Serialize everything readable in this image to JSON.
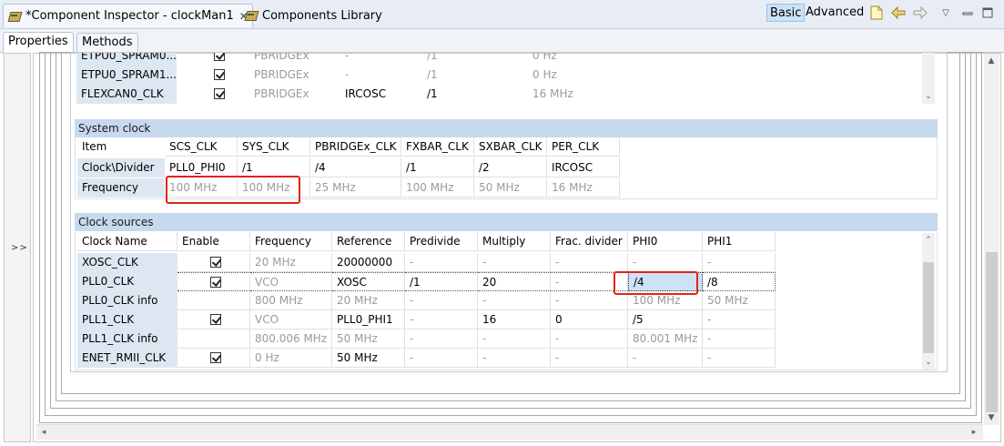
{
  "tabs": {
    "inspector": "*Component Inspector - clockMan1",
    "library": "Components Library"
  },
  "modes": {
    "basic": "Basic",
    "advanced": "Advanced"
  },
  "subtabs": {
    "properties": "Properties",
    "methods": "Methods"
  },
  "collapse_label": ">>",
  "top_table": {
    "rows": [
      {
        "name": "ETPU0_SPRAM0...",
        "enabled": true,
        "bus": "PBRIDGEx",
        "source": "-",
        "divider": "/1",
        "freq": "0 Hz"
      },
      {
        "name": "ETPU0_SPRAM1...",
        "enabled": true,
        "bus": "PBRIDGEx",
        "source": "-",
        "divider": "/1",
        "freq": "0 Hz"
      },
      {
        "name": "FLEXCAN0_CLK",
        "enabled": true,
        "bus": "PBRIDGEx",
        "source": "IRCOSC",
        "divider": "/1",
        "freq": "16 MHz"
      }
    ]
  },
  "system_clock": {
    "title": "System clock",
    "headers": [
      "Item",
      "SCS_CLK",
      "SYS_CLK",
      "PBRIDGEx_CLK",
      "FXBAR_CLK",
      "SXBAR_CLK",
      "PER_CLK"
    ],
    "divider_row": [
      "Clock\\Divider",
      "PLL0_PHI0",
      "/1",
      "/4",
      "/1",
      "/2",
      "IRCOSC"
    ],
    "frequency_row": [
      "Frequency",
      "100 MHz",
      "100 MHz",
      "25 MHz",
      "100 MHz",
      "50 MHz",
      "16 MHz"
    ]
  },
  "clock_sources": {
    "title": "Clock sources",
    "headers": [
      "Clock Name",
      "Enable",
      "Frequency",
      "Reference",
      "Predivide",
      "Multiply",
      "Frac. divider",
      "PHI0",
      "PHI1"
    ],
    "rows": [
      {
        "name": "XOSC_CLK",
        "enable": true,
        "frequency": "20 MHz",
        "reference": "20000000",
        "predivide": "-",
        "multiply": "-",
        "frac": "-",
        "phi0": "-",
        "phi1": "-"
      },
      {
        "name": "PLL0_CLK",
        "enable": true,
        "frequency": "VCO",
        "reference": "XOSC",
        "predivide": "/1",
        "multiply": "20",
        "frac": "-",
        "phi0": "/4",
        "phi1": "/8"
      },
      {
        "name": "PLL0_CLK info",
        "enable": false,
        "frequency": "800 MHz",
        "reference": "20 MHz",
        "predivide": "-",
        "multiply": "-",
        "frac": "-",
        "phi0": "100 MHz",
        "phi1": "50 MHz"
      },
      {
        "name": "PLL1_CLK",
        "enable": true,
        "frequency": "VCO",
        "reference": "PLL0_PHI1",
        "predivide": "-",
        "multiply": "16",
        "frac": "0",
        "phi0": "/5",
        "phi1": "-"
      },
      {
        "name": "PLL1_CLK info",
        "enable": false,
        "frequency": "800.006 MHz",
        "reference": "50 MHz",
        "predivide": "-",
        "multiply": "-",
        "frac": "-",
        "phi0": "80.001 MHz",
        "phi1": "-"
      },
      {
        "name": "ENET_RMII_CLK",
        "enable": true,
        "frequency": "0 Hz",
        "reference": "50 MHz",
        "predivide": "-",
        "multiply": "-",
        "frac": "-",
        "phi0": "-",
        "phi1": "-"
      }
    ]
  },
  "colors": {
    "section_header": "#c7d9ee",
    "row_header": "#dde7f2",
    "highlight": "#e0241b",
    "selection": "#cde1f7"
  }
}
